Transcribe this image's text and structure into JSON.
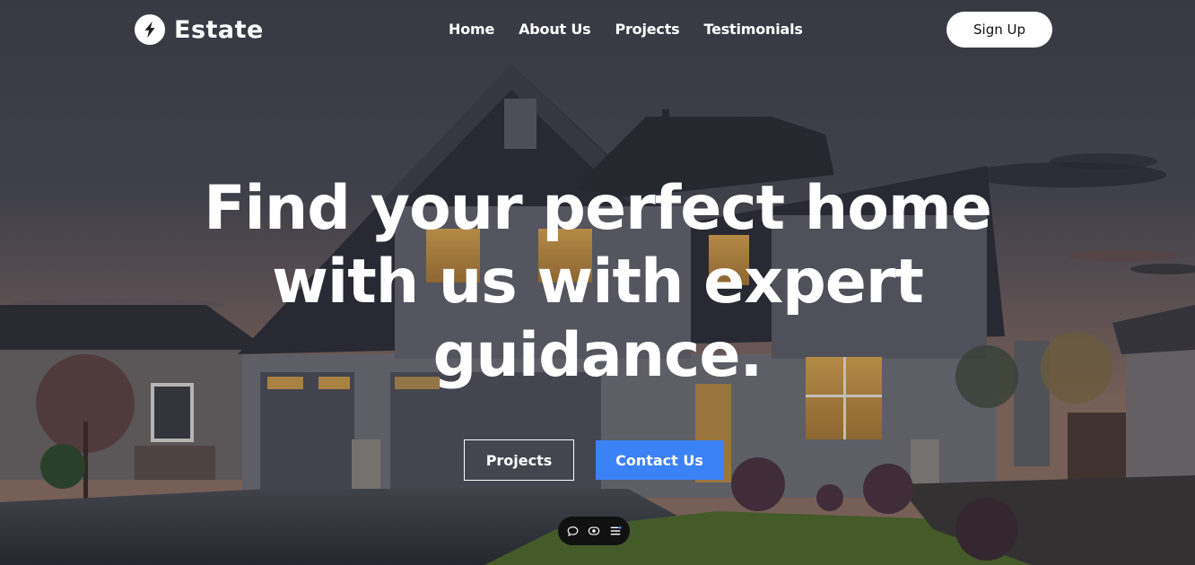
{
  "brand": {
    "name": "Estate",
    "logo_icon": "lightning-bolt-icon"
  },
  "nav": {
    "links": [
      "Home",
      "About Us",
      "Projects",
      "Testimonials"
    ],
    "signup_label": "Sign Up"
  },
  "hero": {
    "headline_lines": [
      "Find your perfect home",
      "with us with expert",
      "guidance."
    ],
    "buttons": {
      "projects_label": "Projects",
      "contact_label": "Contact Us"
    },
    "background": "house-at-dusk-photo"
  },
  "toolbar": {
    "icons": [
      "comment-icon",
      "eye-icon",
      "list-icon"
    ]
  },
  "colors": {
    "accent": "#3b82f6",
    "text": "#ffffff",
    "signup_bg": "#ffffff",
    "toolbar_bg": "#111111"
  }
}
